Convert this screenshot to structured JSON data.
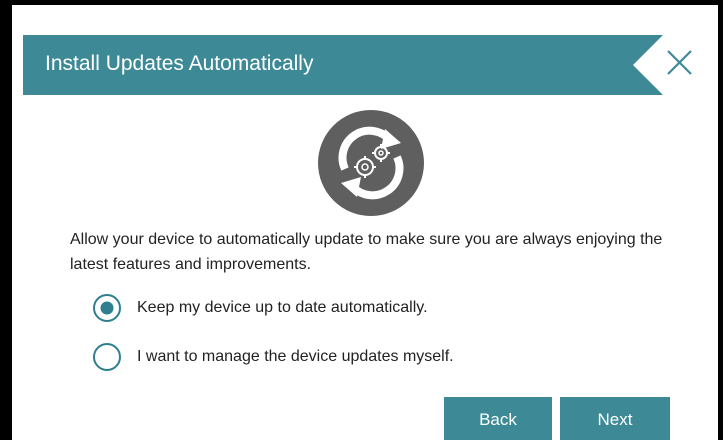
{
  "dialog": {
    "title": "Install Updates Automatically",
    "description": "Allow your device to automatically update to make sure you are always enjoying the latest features and improvements.",
    "options": [
      {
        "label": "Keep my device up to date automatically.",
        "selected": true
      },
      {
        "label": "I want to manage the device updates myself.",
        "selected": false
      }
    ],
    "buttons": {
      "back": "Back",
      "next": "Next"
    }
  },
  "icons": {
    "close": "close-icon",
    "hero": "update-gears-icon"
  },
  "colors": {
    "accent": "#3d8a96",
    "icon_bg": "#5f5f5f",
    "radio": "#2f7f8f"
  }
}
